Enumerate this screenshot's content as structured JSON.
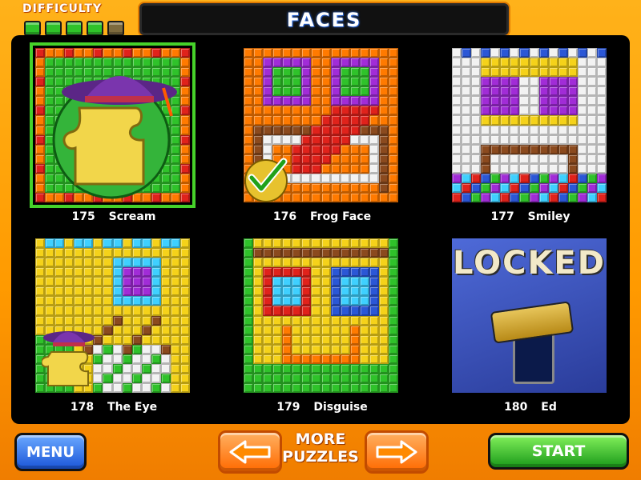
{
  "difficulty": {
    "label": "DIFFICULTY",
    "level": 4,
    "max": 5
  },
  "header": {
    "title": "FACES"
  },
  "puzzles": [
    {
      "number": "175",
      "name": "Scream",
      "state": "selected"
    },
    {
      "number": "176",
      "name": "Frog Face",
      "state": "completed"
    },
    {
      "number": "177",
      "name": "Smiley",
      "state": "available"
    },
    {
      "number": "178",
      "name": "The Eye",
      "state": "in-progress"
    },
    {
      "number": "179",
      "name": "Disguise",
      "state": "available"
    },
    {
      "number": "180",
      "name": "Ed",
      "state": "locked",
      "locked_label": "LOCKED"
    }
  ],
  "buttons": {
    "menu": "MENU",
    "start": "START",
    "more_line1": "MORE",
    "more_line2": "PUZZLES"
  },
  "colors": {
    "green": "#2fc22a",
    "orange": "#ff7a00",
    "yellow": "#f5d21a",
    "purple": "#a12cd7",
    "red": "#e0221b",
    "blue": "#2b57d6"
  },
  "icons": {
    "completed": "checkmark-icon",
    "prev": "left-arrow-icon",
    "next": "right-arrow-icon"
  }
}
